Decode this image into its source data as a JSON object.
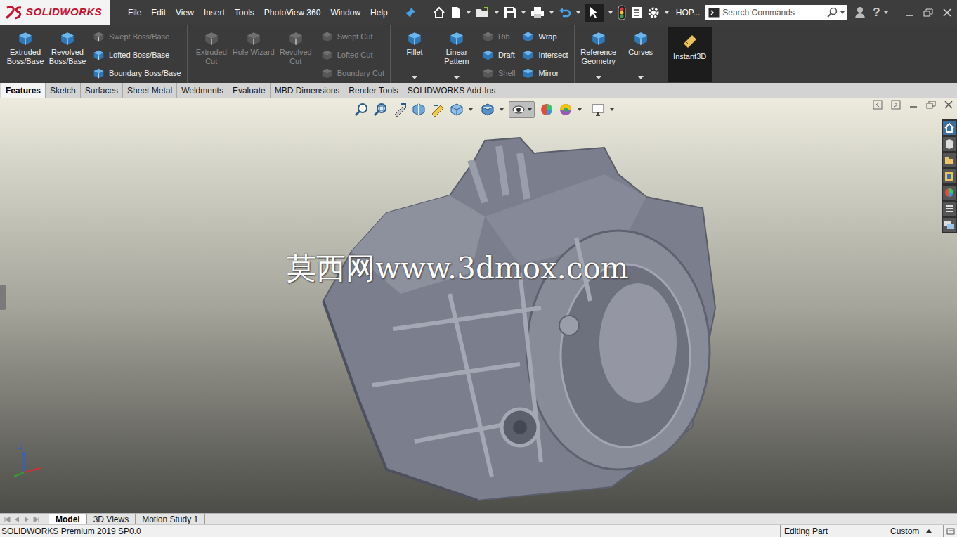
{
  "app": {
    "logo": "SOLIDWORKS"
  },
  "menu": [
    "File",
    "Edit",
    "View",
    "Insert",
    "Tools",
    "PhotoView 360",
    "Window",
    "Help"
  ],
  "document": {
    "title": "HOP..."
  },
  "search": {
    "placeholder": "Search Commands"
  },
  "help": "?",
  "ribbon": {
    "groups": [
      {
        "large": [
          {
            "label": "Extruded Boss/Base",
            "disabled": false,
            "dropdown": false
          },
          {
            "label": "Revolved Boss/Base",
            "disabled": false,
            "dropdown": false
          }
        ],
        "columns": [
          [
            {
              "label": "Swept Boss/Base",
              "disabled": true
            },
            {
              "label": "Lofted Boss/Base",
              "disabled": false
            },
            {
              "label": "Boundary Boss/Base",
              "disabled": false
            }
          ]
        ]
      },
      {
        "large": [
          {
            "label": "Extruded Cut",
            "disabled": true,
            "dropdown": false
          },
          {
            "label": "Hole Wizard",
            "disabled": true,
            "dropdown": false
          },
          {
            "label": "Revolved Cut",
            "disabled": true,
            "dropdown": false
          }
        ],
        "columns": [
          [
            {
              "label": "Swept Cut",
              "disabled": true
            },
            {
              "label": "Lofted Cut",
              "disabled": true
            },
            {
              "label": "Boundary Cut",
              "disabled": true
            }
          ]
        ]
      },
      {
        "large": [
          {
            "label": "Fillet",
            "disabled": false,
            "dropdown": true
          },
          {
            "label": "Linear Pattern",
            "disabled": false,
            "dropdown": true
          }
        ],
        "columns": [
          [
            {
              "label": "Rib",
              "disabled": true
            },
            {
              "label": "Draft",
              "disabled": false
            },
            {
              "label": "Shell",
              "disabled": true
            }
          ],
          [
            {
              "label": "Wrap",
              "disabled": false
            },
            {
              "label": "Intersect",
              "disabled": false
            },
            {
              "label": "Mirror",
              "disabled": false
            }
          ]
        ]
      },
      {
        "large": [
          {
            "label": "Reference Geometry",
            "disabled": false,
            "dropdown": true
          },
          {
            "label": "Curves",
            "disabled": false,
            "dropdown": true
          }
        ],
        "columns": []
      }
    ],
    "instant3d": {
      "label": "Instant3D",
      "on": true
    }
  },
  "command_tabs": [
    {
      "label": "Features",
      "selected": true
    },
    {
      "label": "Sketch",
      "selected": false
    },
    {
      "label": "Surfaces",
      "selected": false
    },
    {
      "label": "Sheet Metal",
      "selected": false
    },
    {
      "label": "Weldments",
      "selected": false
    },
    {
      "label": "Evaluate",
      "selected": false
    },
    {
      "label": "MBD Dimensions",
      "selected": false
    },
    {
      "label": "Render Tools",
      "selected": false
    },
    {
      "label": "SOLIDWORKS Add-Ins",
      "selected": false
    }
  ],
  "viewport": {
    "watermark": "莫西网www.3dmox.com",
    "triad_label": "Z"
  },
  "model_tabs": [
    {
      "label": "Model",
      "selected": true
    },
    {
      "label": "3D Views",
      "selected": false
    },
    {
      "label": "Motion Study 1",
      "selected": false
    }
  ],
  "status_bar": {
    "product": "SOLIDWORKS Premium 2019 SP0.0",
    "mode": "Editing Part",
    "units": "Custom"
  }
}
